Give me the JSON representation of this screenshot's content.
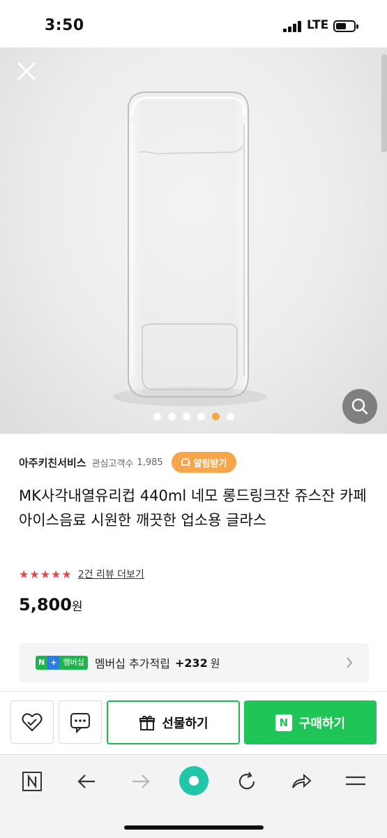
{
  "status_bar": {
    "time": "3:50",
    "network": "LTE"
  },
  "gallery": {
    "dots_total": 6,
    "active_dot": 4,
    "close_icon": "close-icon",
    "zoom_icon": "search-icon"
  },
  "store": {
    "name": "아주키친서비스",
    "follower_label": "관심고객수",
    "follower_count": "1,985",
    "alarm_label": "알림받기"
  },
  "product": {
    "title": "MK사각내열유리컵 440ml 네모 롱드링크잔 쥬스잔 카페 아이스음료 시원한 깨끗한 업소용 글라스",
    "stars": "★★★★★",
    "rating_stars": 5,
    "review_link": "2건 리뷰 더보기",
    "price": "5,800",
    "currency": "원"
  },
  "membership": {
    "badge_n": "N",
    "badge_plus": "+",
    "badge_text": "멤버십",
    "label": "멤버십 추가적립",
    "points": "+232",
    "unit": "원"
  },
  "actions": {
    "gift_label": "선물하기",
    "buy_badge": "N",
    "buy_label": "구매하기"
  },
  "colors": {
    "accent_green": "#1fc556",
    "alarm_orange": "#f5a64b",
    "star_red": "#ea4449",
    "active_dot": "#f3a64c"
  }
}
